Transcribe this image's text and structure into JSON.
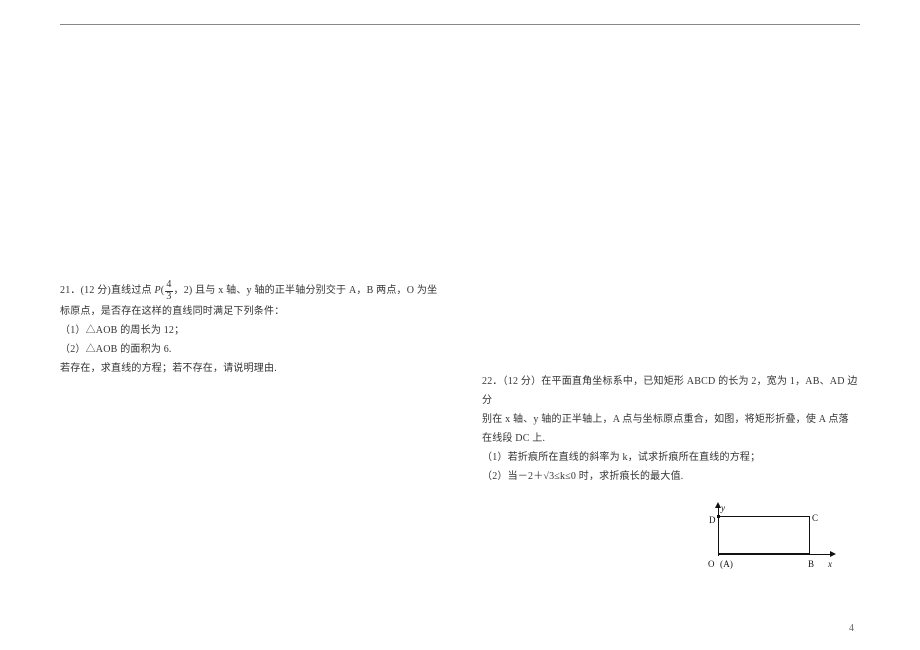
{
  "page_number": "4",
  "q21": {
    "head_a": "21．(12 分)直线过点 ",
    "head_point_P": "P",
    "head_frac_num": "4",
    "head_frac_den": "3",
    "head_after_paren_open": "(",
    "head_after_comma": "，2)",
    "head_b": "且与 x 轴、y 轴的正半轴分别交于 A，B 两点，O 为坐",
    "line2": "标原点，是否存在这样的直线同时满足下列条件：",
    "cond1": "（1）△AOB 的周长为 12；",
    "cond2": "（2）△AOB 的面积为 6.",
    "tail": "若存在，求直线的方程；若不存在，请说明理由."
  },
  "q22": {
    "line1": "22．（12 分）在平面直角坐标系中，已知矩形 ABCD 的长为 2，宽为 1，AB、AD 边分",
    "line2": "别在 x 轴、y 轴的正半轴上，A 点与坐标原点重合，如图，将矩形折叠，使 A 点落",
    "line3": "在线段 DC 上.",
    "part1": "（1）若折痕所在直线的斜率为 k，试求折痕所在直线的方程；",
    "part2_a": "（2）当－2＋",
    "part2_sqrt": "√3",
    "part2_b": "≤k≤0 时，求折痕长的最大值."
  },
  "fig": {
    "y": "y",
    "x": "x",
    "D": "D",
    "C": "C",
    "O": "O",
    "A": "(A)",
    "B": "B"
  }
}
